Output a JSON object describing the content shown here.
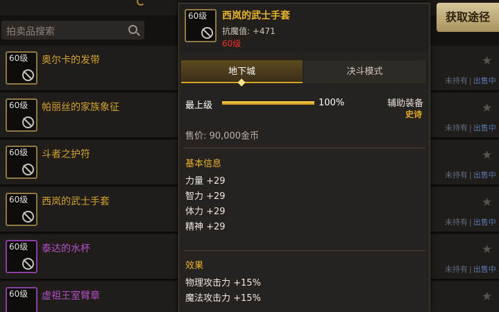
{
  "search": {
    "placeholder": "拍卖品搜索"
  },
  "acquire_button": {
    "label": "获取途径"
  },
  "items": [
    {
      "level": "60级",
      "name": "奥尔卡的发带",
      "rarity": "epic",
      "status_owned": "未持有",
      "status_sale": "出售中"
    },
    {
      "level": "60级",
      "name": "帕丽丝的家族象征",
      "rarity": "epic",
      "status_owned": "未持有",
      "status_sale": "出售中"
    },
    {
      "level": "60级",
      "name": "斗者之护符",
      "rarity": "epic",
      "status_owned": "未持有",
      "status_sale": "出售中"
    },
    {
      "level": "60级",
      "name": "西岚的武士手套",
      "rarity": "epic",
      "status_owned": "未持有",
      "status_sale": "出售中"
    },
    {
      "level": "60级",
      "name": "泰达的水杯",
      "rarity": "unique",
      "status_owned": "未持有",
      "status_sale": "出售中"
    },
    {
      "level": "60级",
      "name": "虚祖王室臂章",
      "rarity": "unique",
      "status_owned": "",
      "status_sale": ""
    }
  ],
  "tooltip": {
    "level": "60级",
    "name": "西岚的武士手套",
    "resist": "抗魔值: +471",
    "required_level": "60级",
    "tabs": {
      "dungeon": "地下城",
      "duel": "决斗模式"
    },
    "grade_label": "最上级",
    "grade_value": "100%",
    "grade_percent": 100,
    "item_type": "辅助装备",
    "rarity": "史诗",
    "price": "售价: 90,000金币",
    "basic_info_title": "基本信息",
    "stats": [
      "力量 +29",
      "智力 +29",
      "体力 +29",
      "精神 +29"
    ],
    "effect_title": "效果",
    "effects": [
      "物理攻击力 +15%",
      "魔法攻击力 +15%"
    ]
  },
  "colors": {
    "epic_name": "#d2a232",
    "unique_name": "#b450c8",
    "required_level": "#e8322a",
    "accent_gold": "#e8b52f"
  }
}
